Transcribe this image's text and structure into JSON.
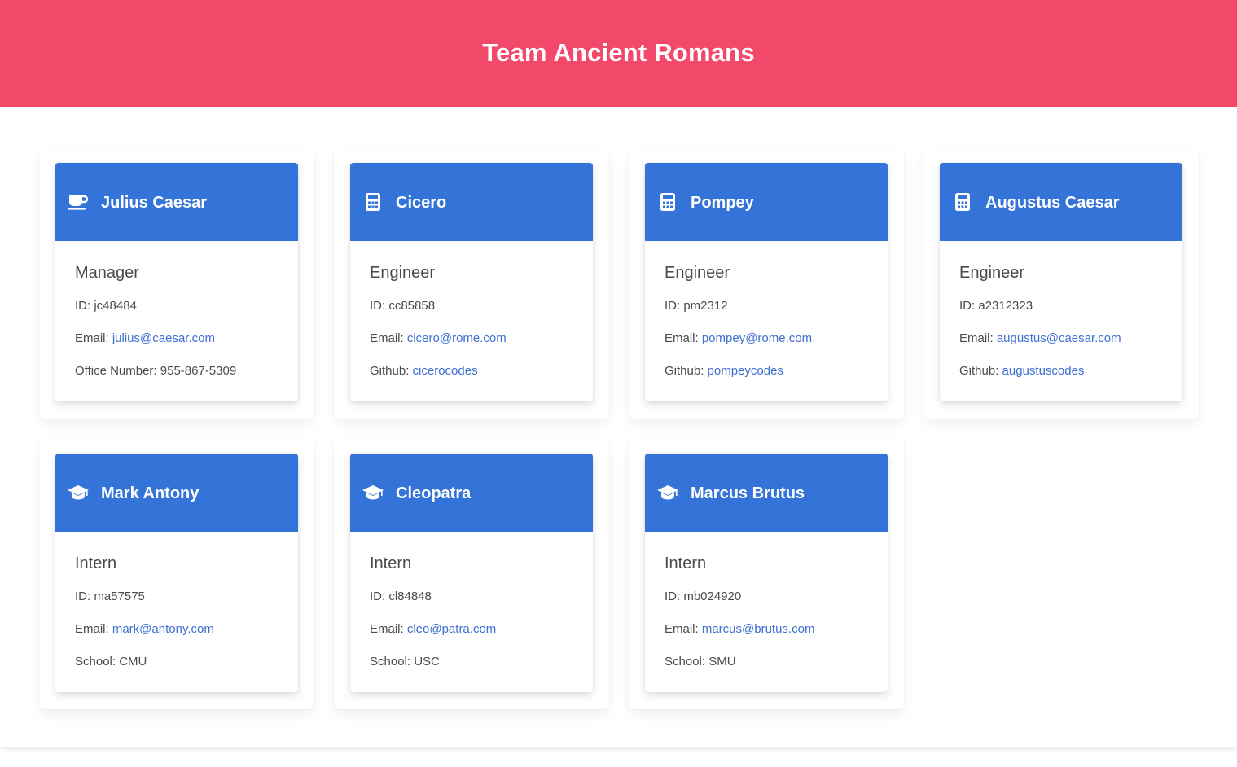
{
  "header": {
    "title": "Team Ancient Romans"
  },
  "colors": {
    "header_bg": "#f2486a",
    "card_header_bg": "#3474d9",
    "link": "#3e6fd1"
  },
  "employees": [
    {
      "name": "Julius Caesar",
      "icon": "coffee-mug-icon",
      "role": "Manager",
      "id_label": "ID:",
      "id": "jc48484",
      "email_label": "Email:",
      "email": "julius@caesar.com",
      "extra_label": "Office Number:",
      "extra": "955-867-5309"
    },
    {
      "name": "Cicero",
      "icon": "calculator-icon",
      "role": "Engineer",
      "id_label": "ID:",
      "id": "cc85858",
      "email_label": "Email:",
      "email": "cicero@rome.com",
      "extra_label": "Github:",
      "extra": "cicerocodes"
    },
    {
      "name": "Pompey",
      "icon": "calculator-icon",
      "role": "Engineer",
      "id_label": "ID:",
      "id": "pm2312",
      "email_label": "Email:",
      "email": "pompey@rome.com",
      "extra_label": "Github:",
      "extra": "pompeycodes"
    },
    {
      "name": "Augustus Caesar",
      "icon": "calculator-icon",
      "role": "Engineer",
      "id_label": "ID:",
      "id": "a2312323",
      "email_label": "Email:",
      "email": "augustus@caesar.com",
      "extra_label": "Github:",
      "extra": "augustuscodes"
    },
    {
      "name": "Mark Antony",
      "icon": "graduation-cap-icon",
      "role": "Intern",
      "id_label": "ID:",
      "id": "ma57575",
      "email_label": "Email:",
      "email": "mark@antony.com",
      "extra_label": "School:",
      "extra": "CMU"
    },
    {
      "name": "Cleopatra",
      "icon": "graduation-cap-icon",
      "role": "Intern",
      "id_label": "ID:",
      "id": "cl84848",
      "email_label": "Email:",
      "email": "cleo@patra.com",
      "extra_label": "School:",
      "extra": "USC"
    },
    {
      "name": "Marcus Brutus",
      "icon": "graduation-cap-icon",
      "role": "Intern",
      "id_label": "ID:",
      "id": "mb024920",
      "email_label": "Email:",
      "email": "marcus@brutus.com",
      "extra_label": "School:",
      "extra": "SMU"
    }
  ]
}
